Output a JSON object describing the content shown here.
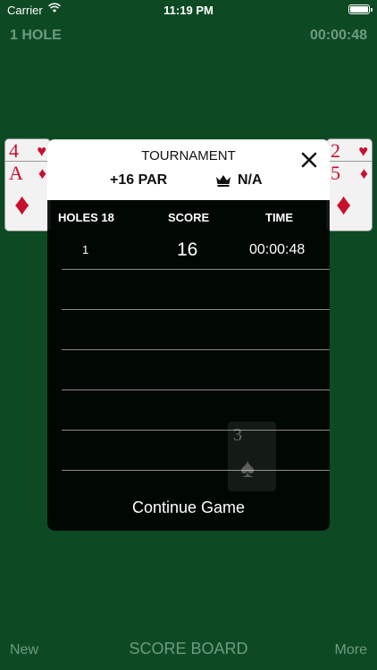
{
  "status_bar": {
    "carrier": "Carrier",
    "time": "11:19 PM"
  },
  "header": {
    "hole": "1 HOLE",
    "timer": "00:00:48"
  },
  "cards": {
    "left": {
      "rank_top": "4",
      "suit_top": "♥",
      "rank": "A",
      "suit": "♦",
      "big_suit": "♦"
    },
    "right": {
      "rank_top": "2",
      "suit_top": "♥",
      "rank": "5",
      "suit": "♦",
      "big_suit": "♦"
    },
    "ghost": {
      "rank": "3",
      "suit": "♠"
    }
  },
  "modal": {
    "title": "TOURNAMENT",
    "par": "+16 PAR",
    "best": "N/A",
    "columns": {
      "holes": "HOLES 18",
      "score": "SCORE",
      "time": "TIME"
    },
    "rows": [
      {
        "hole": "1",
        "score": "16",
        "time": "00:00:48"
      }
    ],
    "continue_label": "Continue Game"
  },
  "toolbar": {
    "new": "New",
    "score_board": "SCORE BOARD",
    "more": "More"
  },
  "colors": {
    "felt": "#0d4a24",
    "muted_text": "#6f9a7f",
    "card_red": "#c8102e"
  }
}
